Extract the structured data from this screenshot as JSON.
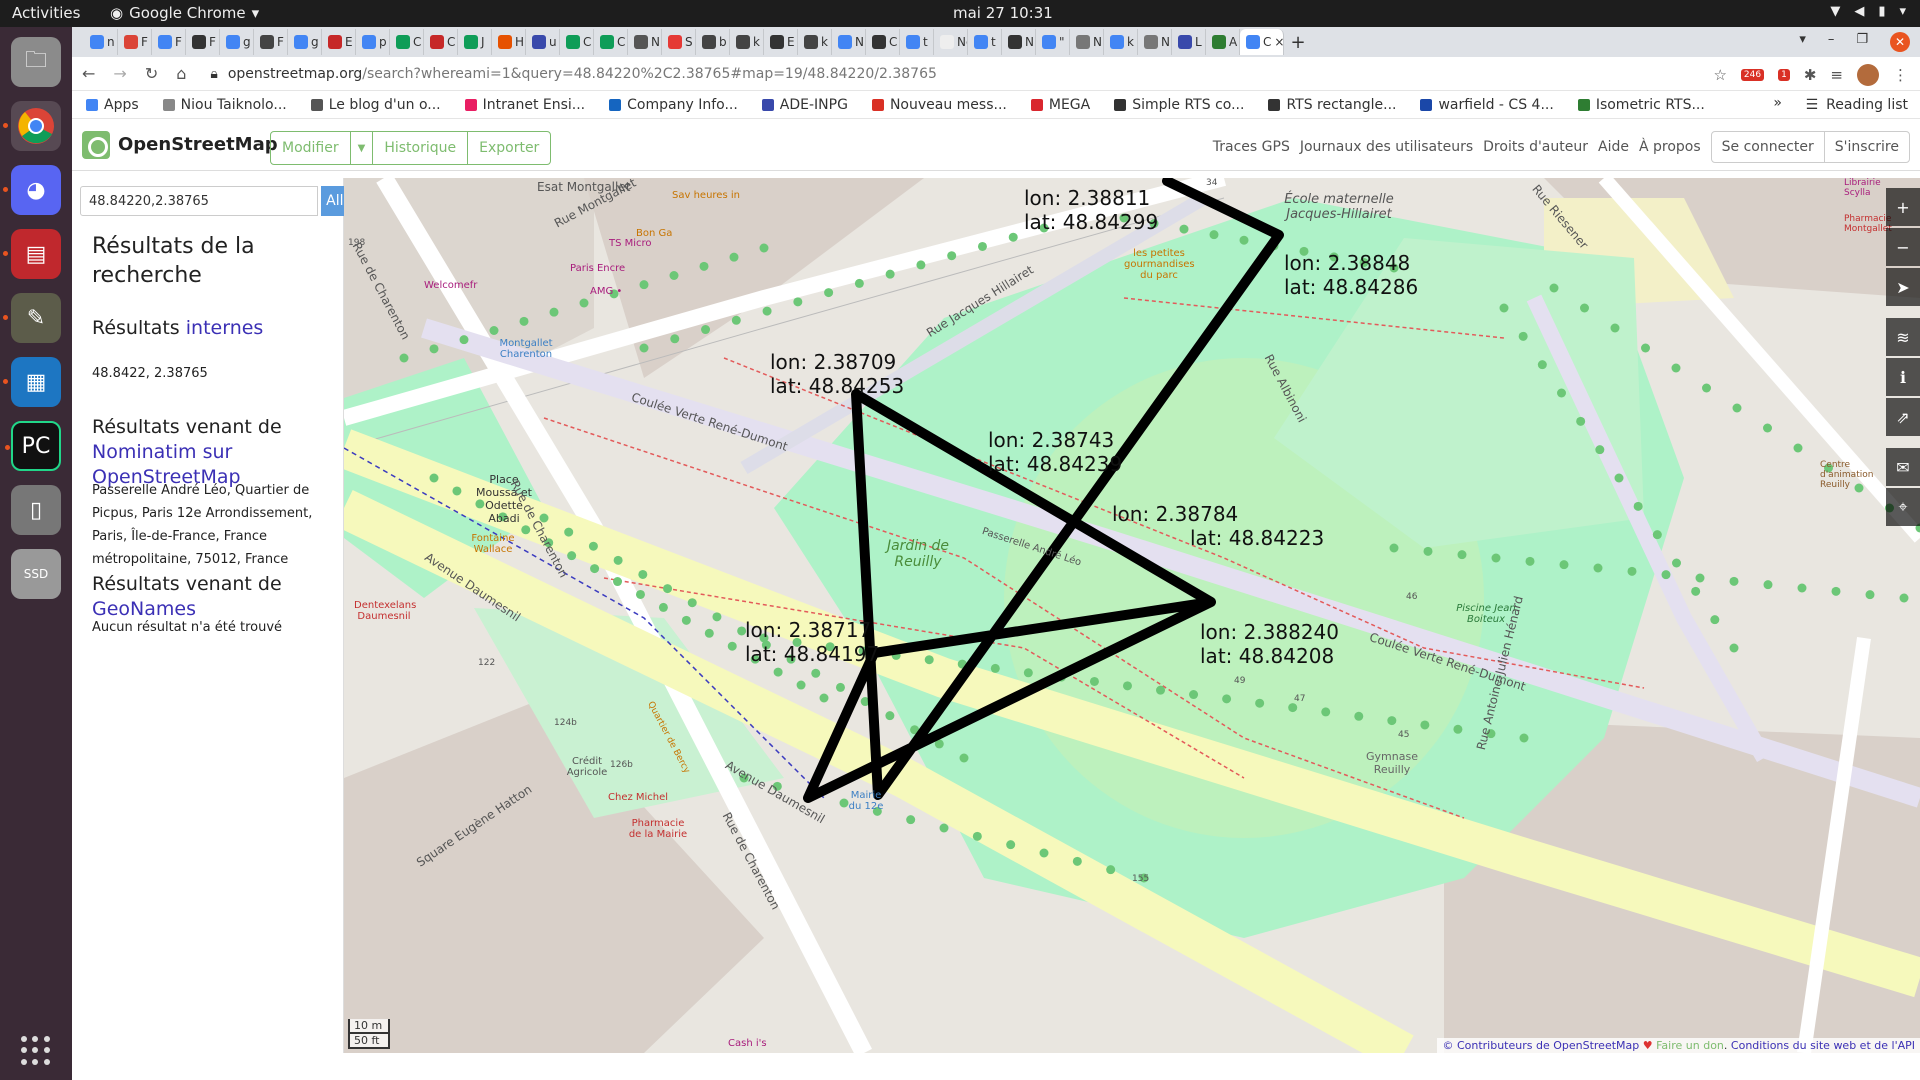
{
  "system": {
    "activities": "Activities",
    "app_name": "Google Chrome",
    "clock": "mai 27  10:31"
  },
  "browser": {
    "tabs": [
      "n",
      "F",
      "F",
      "F",
      "g",
      "F",
      "g",
      "E",
      "p",
      "C",
      "C",
      "J",
      "H",
      "u",
      "C",
      "C",
      "N",
      "S",
      "b",
      "k",
      "E",
      "k",
      "N",
      "C",
      "t",
      "New",
      "t",
      "N",
      "\"",
      "N",
      "k",
      "N",
      "L",
      "A",
      "C"
    ],
    "active_tab_label": "C",
    "url_host": "openstreetmap.org",
    "url_path": "/search?whereami=1&query=48.84220%2C2.38765#map=19/48.84220/2.38765",
    "ext_badge": "246",
    "ext_badge2": "1",
    "bookmarks": [
      {
        "label": "Apps",
        "color": "#4285f4"
      },
      {
        "label": "Niou Taiknolo...",
        "color": "#888888"
      },
      {
        "label": "Le blog d'un o...",
        "color": "#555555"
      },
      {
        "label": "Intranet Ensi...",
        "color": "#e91e63"
      },
      {
        "label": "Company Info...",
        "color": "#1565c0"
      },
      {
        "label": "ADE-INPG",
        "color": "#3949ab"
      },
      {
        "label": "Nouveau mess...",
        "color": "#d93025"
      },
      {
        "label": "MEGA",
        "color": "#d9272e"
      },
      {
        "label": "Simple RTS co...",
        "color": "#333333"
      },
      {
        "label": "RTS rectangle...",
        "color": "#333333"
      },
      {
        "label": "warfield - CS 4...",
        "color": "#1a47a8"
      },
      {
        "label": "Isometric RTS...",
        "color": "#2e7d32"
      }
    ],
    "bookmarks_more": "»",
    "reading_list": "Reading list"
  },
  "osm": {
    "brand": "OpenStreetMap",
    "edit": "Modifier",
    "history": "Historique",
    "export": "Exporter",
    "nav": [
      "Traces GPS",
      "Journaux des utilisateurs",
      "Droits d'auteur",
      "Aide",
      "À propos"
    ],
    "login": "Se connecter",
    "signup": "S'inscrire"
  },
  "search": {
    "query": "48.84220,2.38765",
    "go": "Aller"
  },
  "results": {
    "title": "Résultats de la recherche",
    "internal_prefix": "Résultats ",
    "internal_link": "internes",
    "internal_value": "48.8422, 2.38765",
    "nominatim_prefix": "Résultats venant de ",
    "nominatim_link": "Nominatim sur OpenStreetMap",
    "nominatim_value": "Passerelle André Léo, Quartier de Picpus, Paris 12e Arrondissement, Paris, Île-de-France, France métropolitaine, 75012, France",
    "geonames_prefix": "Résultats venant de ",
    "geonames_link": "GeoNames",
    "geonames_value": "Aucun résultat n'a été trouvé"
  },
  "map": {
    "scale_m": "10 m",
    "scale_ft": "50 ft",
    "attribution_link1": "© Contributeurs de OpenStreetMap",
    "attribution_sep": " ♥ ",
    "attribution_link2": "Faire un don",
    "attribution_link3": "Conditions du site web et de l'API",
    "coord_labels": [
      {
        "lon": "lon: 2.38811",
        "lat": "lat: 48.84299"
      },
      {
        "lon": "lon: 2.38848",
        "lat": "lat: 48.84286"
      },
      {
        "lon": "lon: 2.38709",
        "lat": "lat: 48.84253"
      },
      {
        "lon": "lon: 2.38743",
        "lat": "lat: 48.84239"
      },
      {
        "lon": "lon: 2.38784",
        "lat": "lat: 48.84223"
      },
      {
        "lon": "lon: 2.38717",
        "lat": "lat: 48.84197"
      },
      {
        "lon": "lon: 2.388240",
        "lat": "lat: 48.84208"
      }
    ],
    "labels": {
      "esat": "Esat Montgallet",
      "sav": "Sav heures in",
      "bonga": "Bon Ga",
      "tsmicro": "TS Micro",
      "parisencre": "Paris Encre",
      "amg": "AMG •",
      "welcome": "Welcomefr",
      "ecole": "École maternelle Jacques-Hillairet",
      "petites": "les petites gourmandises du parc",
      "montgallet_ch": "Montgallet Charenton",
      "place_moussa": "Place Moussa et Odette Abadi",
      "fontaine": "Fontaine Wallace",
      "dentexelans": "Dentexelans Daumesnil",
      "jardin": "Jardin de Reuilly",
      "piscine": "Piscine Jean Boiteux",
      "gymnase": "Gymnase Reuilly",
      "credit": "Crédit Agricole",
      "chez_michel": "Chez Michel",
      "pharmacie": "Pharmacie de la Mairie",
      "mairie": "Mairie du 12e",
      "cash": "Cash i's",
      "librairie": "Librairie Scylla",
      "pharmacie2": "Pharmacie Montgallet",
      "centre": "Centre d'animation Reuilly",
      "rue_charenton": "Rue de Charenton",
      "rue_montgallet": "Rue Montgallet",
      "rue_hillairet": "Rue Jacques Hillairet",
      "coulee": "Coulée Verte René-Dumont",
      "coulee2": "Coulée Verte René-Dumont",
      "av_daumesnil": "Avenue Daumesnil",
      "rue_albinoni": "Rue Albinoni",
      "rue_riesener": "Rue Riesener",
      "rue_henard": "Rue Antoine-Julien Hénard",
      "sq_hatton": "Square Eugène Hatton",
      "quartier_bercy": "Quartier de Bercy",
      "passerelle": "Passerelle André Léo",
      "num_34": "34",
      "num_198": "198",
      "num_122": "122",
      "num_124b": "124b",
      "num_126b": "126b",
      "num_155": "155",
      "num_49": "49",
      "num_47": "47",
      "num_46": "46",
      "num_45": "45"
    }
  }
}
